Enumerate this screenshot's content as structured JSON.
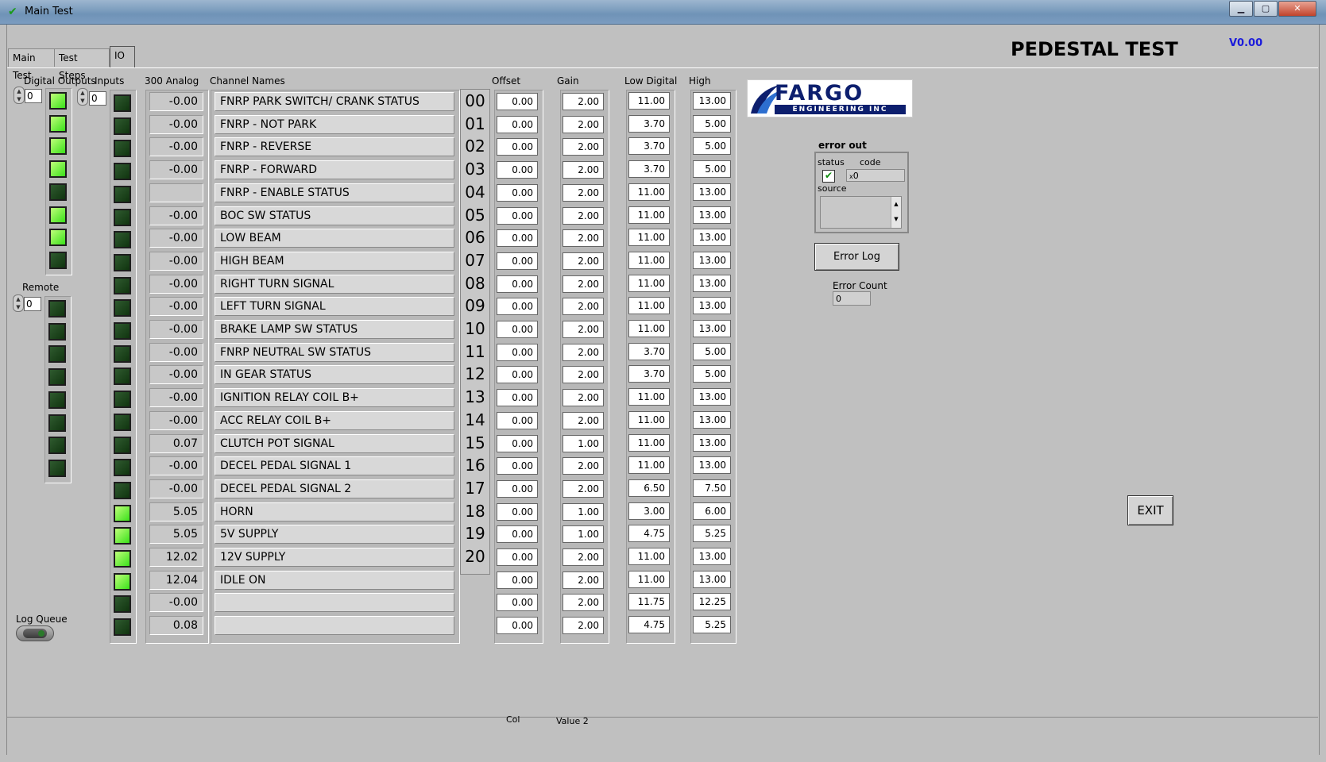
{
  "window": {
    "title": "Main Test"
  },
  "tabs": [
    {
      "label": "Main Test",
      "active": false
    },
    {
      "label": "Test Steps",
      "active": false
    },
    {
      "label": "IO",
      "active": true
    }
  ],
  "header": {
    "title": "PEDESTAL TEST",
    "version": "V0.00"
  },
  "column_labels": {
    "digital_outputs": "Digital Outputs",
    "inputs": "Inputs",
    "analog": "300 Analog",
    "channel_names": "Channel Names",
    "offset": "Offset",
    "gain": "Gain",
    "low_digital": "Low Digital",
    "high": "High"
  },
  "digital_outputs": {
    "index": "0",
    "states": [
      true,
      true,
      true,
      true,
      false,
      true,
      true,
      false
    ]
  },
  "inputs": {
    "index": "0",
    "states": [
      false,
      false,
      false,
      false,
      false,
      false,
      false,
      false,
      false,
      false,
      false,
      false,
      false,
      false,
      false,
      false,
      false,
      false,
      true,
      true,
      true,
      true,
      false,
      false
    ]
  },
  "remote": {
    "label": "Remote",
    "index": "0",
    "states": [
      false,
      false,
      false,
      false,
      false,
      false,
      false,
      false
    ]
  },
  "log_queue": {
    "label": "Log Queue"
  },
  "analog_values": [
    "-0.00",
    "-0.00",
    "-0.00",
    "-0.00",
    "",
    "-0.00",
    "-0.00",
    "-0.00",
    "-0.00",
    "-0.00",
    "-0.00",
    "-0.00",
    "-0.00",
    "-0.00",
    "-0.00",
    "0.07",
    "-0.00",
    "-0.00",
    "5.05",
    "5.05",
    "12.02",
    "12.04",
    "-0.00",
    "0.08"
  ],
  "channel_names": [
    "FNRP PARK SWITCH/ CRANK STATUS",
    "FNRP - NOT PARK",
    "FNRP - REVERSE",
    "FNRP - FORWARD",
    "FNRP - ENABLE STATUS",
    "BOC SW STATUS",
    "LOW BEAM",
    "HIGH BEAM",
    "RIGHT TURN SIGNAL",
    "LEFT TURN SIGNAL",
    "BRAKE LAMP SW STATUS",
    "FNRP NEUTRAL SW STATUS",
    "IN GEAR STATUS",
    "IGNITION RELAY COIL B+",
    "ACC RELAY COIL B+",
    "CLUTCH POT SIGNAL",
    "DECEL PEDAL SIGNAL 1",
    "DECEL PEDAL SIGNAL 2",
    "HORN",
    "5V SUPPLY",
    "12V SUPPLY",
    "IDLE ON",
    "",
    ""
  ],
  "channel_indices": [
    "00",
    "01",
    "02",
    "03",
    "04",
    "05",
    "06",
    "07",
    "08",
    "09",
    "10",
    "11",
    "12",
    "13",
    "14",
    "15",
    "16",
    "17",
    "18",
    "19",
    "20"
  ],
  "offsets": [
    "0.00",
    "0.00",
    "0.00",
    "0.00",
    "0.00",
    "0.00",
    "0.00",
    "0.00",
    "0.00",
    "0.00",
    "0.00",
    "0.00",
    "0.00",
    "0.00",
    "0.00",
    "0.00",
    "0.00",
    "0.00",
    "0.00",
    "0.00",
    "0.00",
    "0.00",
    "0.00",
    "0.00"
  ],
  "gains": [
    "2.00",
    "2.00",
    "2.00",
    "2.00",
    "2.00",
    "2.00",
    "2.00",
    "2.00",
    "2.00",
    "2.00",
    "2.00",
    "2.00",
    "2.00",
    "2.00",
    "2.00",
    "1.00",
    "2.00",
    "2.00",
    "1.00",
    "1.00",
    "2.00",
    "2.00",
    "2.00",
    "2.00"
  ],
  "low_digital": [
    "11.00",
    "3.70",
    "3.70",
    "3.70",
    "11.00",
    "11.00",
    "11.00",
    "11.00",
    "11.00",
    "11.00",
    "11.00",
    "3.70",
    "3.70",
    "11.00",
    "11.00",
    "11.00",
    "11.00",
    "6.50",
    "3.00",
    "4.75",
    "11.00",
    "11.00",
    "11.75",
    "4.75"
  ],
  "high": [
    "13.00",
    "5.00",
    "5.00",
    "5.00",
    "13.00",
    "13.00",
    "13.00",
    "13.00",
    "13.00",
    "13.00",
    "13.00",
    "5.00",
    "5.00",
    "13.00",
    "13.00",
    "13.00",
    "13.00",
    "7.50",
    "6.00",
    "5.25",
    "13.00",
    "13.00",
    "12.25",
    "5.25"
  ],
  "logo": {
    "line1": "FARGO",
    "line2": "ENGINEERING INC",
    "brand_color": "#0d1f6e"
  },
  "error_out": {
    "label": "error out",
    "status_label": "status",
    "code_label": "code",
    "code_prefix": "x",
    "code_value": "0",
    "source_label": "source",
    "status_checked": true
  },
  "error_log_button": "Error  Log",
  "error_count": {
    "label": "Error Count",
    "value": "0"
  },
  "exit_button": "EXIT",
  "footer": {
    "col_label": "Col",
    "value2_label": "Value 2"
  },
  "colors": {
    "led_on": "#3ae01a",
    "led_off": "#1d3f1d",
    "version": "#1a1adb"
  }
}
